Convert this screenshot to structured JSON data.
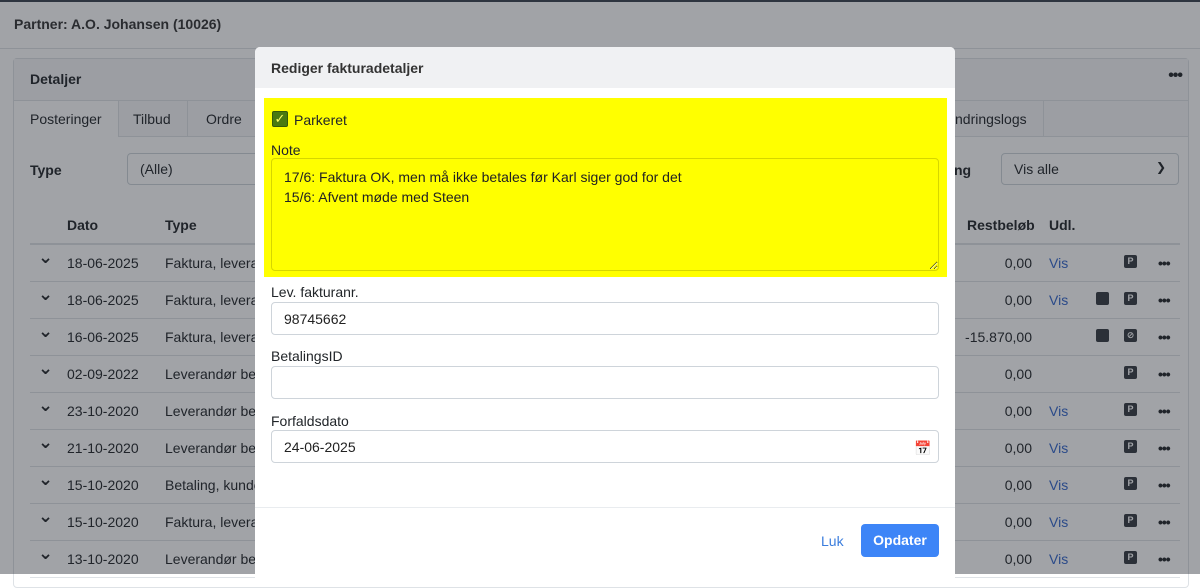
{
  "page": {
    "partner": "Partner: A.O. Johansen (10026)"
  },
  "card": {
    "title": "Detaljer",
    "menu": "•••",
    "tabs": [
      "Posteringer",
      "Tilbud",
      "Ordre",
      "ndringslogs"
    ],
    "filters": {
      "type_label": "Type",
      "type_value": "(Alle)",
      "second_label": "ng",
      "second_value": "Vis alle"
    }
  },
  "table": {
    "headers": {
      "dato": "Dato",
      "type": "Type",
      "restbelob": "Restbeløb",
      "udl": "Udl."
    },
    "rows": [
      {
        "date": "18-06-2025",
        "type": "Faktura, leveran",
        "rest": "0,00",
        "vis": "Vis",
        "note": false,
        "parked": "P"
      },
      {
        "date": "18-06-2025",
        "type": "Faktura, leveran",
        "rest": "0,00",
        "vis": "Vis",
        "note": true,
        "parked": "P"
      },
      {
        "date": "16-06-2025",
        "type": "Faktura, leveran",
        "rest": "-15.870,00",
        "vis": "",
        "note": true,
        "parked": "unparked"
      },
      {
        "date": "02-09-2022",
        "type": "Leverandør bet",
        "rest": "0,00",
        "vis": "",
        "note": false,
        "parked": "P"
      },
      {
        "date": "23-10-2020",
        "type": "Leverandør bet",
        "rest": "0,00",
        "vis": "Vis",
        "note": false,
        "parked": "P"
      },
      {
        "date": "21-10-2020",
        "type": "Leverandør bet",
        "rest": "0,00",
        "vis": "Vis",
        "note": false,
        "parked": "P"
      },
      {
        "date": "15-10-2020",
        "type": "Betaling, kunde",
        "rest": "0,00",
        "vis": "Vis",
        "note": false,
        "parked": "P"
      },
      {
        "date": "15-10-2020",
        "type": "Faktura, leveran",
        "rest": "0,00",
        "vis": "Vis",
        "note": false,
        "parked": "P"
      },
      {
        "date": "13-10-2020",
        "type": "Leverandør bet",
        "rest": "0,00",
        "vis": "Vis",
        "note": false,
        "parked": "P"
      }
    ]
  },
  "modal": {
    "title": "Rediger fakturadetaljer",
    "parked_label": "Parkeret",
    "parked_checked": true,
    "note_label": "Note",
    "note_value": "17/6: Faktura OK, men må ikke betales før Karl siger god for det\n15/6: Afvent møde med Steen",
    "highlight_color": "#ffff00",
    "invoice_label": "Lev. fakturanr.",
    "invoice_value": "98745662",
    "payment_id_label": "BetalingsID",
    "payment_id_value": "",
    "due_label": "Forfaldsdato",
    "due_value": "24-06-2025",
    "close_label": "Luk",
    "update_label": "Opdater"
  }
}
